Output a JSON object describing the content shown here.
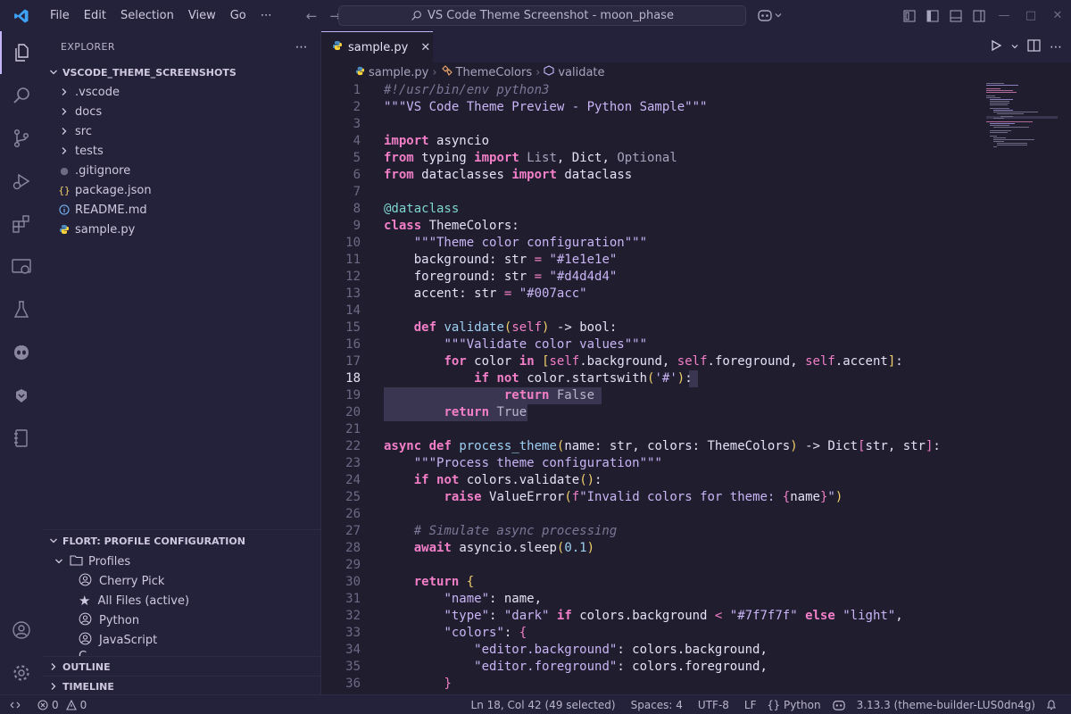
{
  "titlebar": {
    "menus": [
      "File",
      "Edit",
      "Selection",
      "View",
      "Go",
      "⋯"
    ],
    "search_text": "VS Code Theme Screenshot - moon_phase"
  },
  "sidebar": {
    "title": "EXPLORER",
    "root": "VSCODE_THEME_SCREENSHOTS",
    "folders": [
      ".vscode",
      "docs",
      "src",
      "tests"
    ],
    "files": [
      ".gitignore",
      "package.json",
      "README.md",
      "sample.py"
    ],
    "profile_section": "FLORT: PROFILE CONFIGURATION",
    "profiles_label": "Profiles",
    "profiles": [
      "Cherry Pick",
      "All Files (active)",
      "Python",
      "JavaScript",
      "C..."
    ],
    "outline": "OUTLINE",
    "timeline": "TIMELINE"
  },
  "editor": {
    "tab_label": "sample.py",
    "breadcrumb": [
      "sample.py",
      "ThemeColors",
      "validate"
    ],
    "current_line": 18
  },
  "status": {
    "errors": "0",
    "warnings": "0",
    "position": "Ln 18, Col 42 (49 selected)",
    "spaces": "Spaces: 4",
    "encoding": "UTF-8",
    "eol": "LF",
    "language": "Python",
    "interpreter": "3.13.3 (theme-builder-LUS0dn4g)"
  },
  "colors": {
    "background": "#1f1d2e",
    "panel": "#24213a",
    "keyword": "#f27fc7",
    "string": "#c9b5f5",
    "function": "#9fd0f2",
    "accent": "#c4b5f7"
  }
}
